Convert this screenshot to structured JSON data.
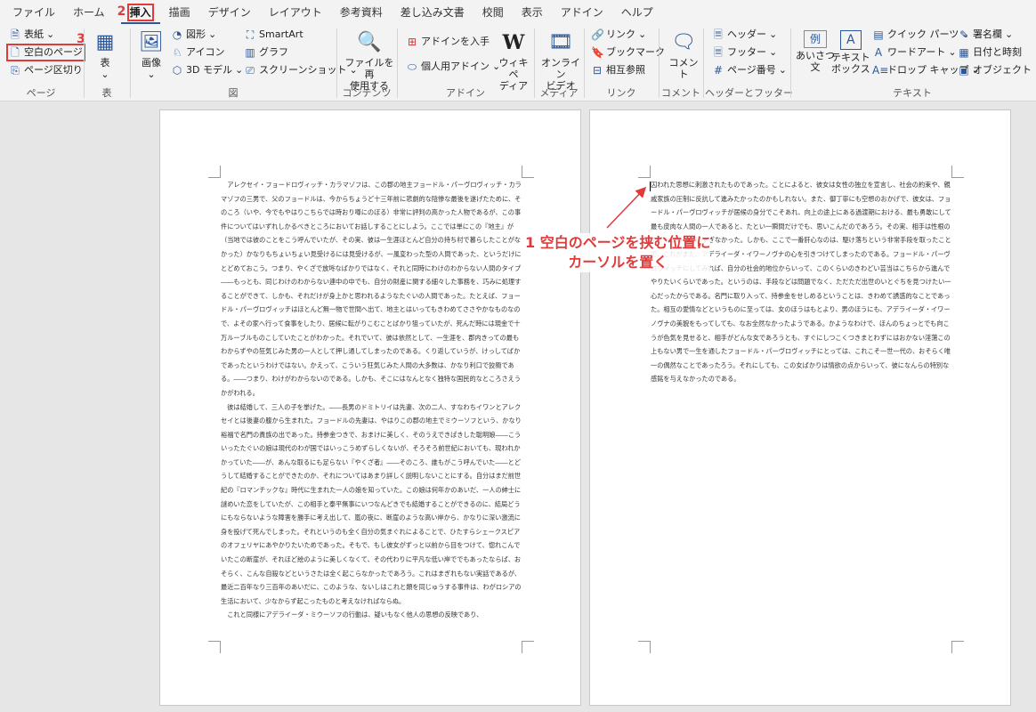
{
  "menu": {
    "tabs": [
      "ファイル",
      "ホーム",
      "挿入",
      "描画",
      "デザイン",
      "レイアウト",
      "参考資料",
      "差し込み文書",
      "校閲",
      "表示",
      "アドイン",
      "ヘルプ"
    ],
    "active_tab": "挿入"
  },
  "steps": {
    "step1": "1",
    "step2": "2",
    "step3": "3"
  },
  "ribbon": {
    "pages": {
      "label": "ページ",
      "cover": "表紙",
      "blank": "空白のページ",
      "break": "ページ区切り"
    },
    "table": {
      "label": "表",
      "button": "表"
    },
    "illustrations": {
      "label": "図",
      "picture": "画像",
      "shapes": "図形",
      "icons": "アイコン",
      "3d": "3D モデル",
      "smartart": "SmartArt",
      "chart": "グラフ",
      "screenshot": "スクリーンショット"
    },
    "content": {
      "label": "コンテンツ",
      "reuse_line1": "ファイルを再",
      "reuse_line2": "使用する"
    },
    "addins": {
      "label": "アドイン",
      "get": "アドインを入手",
      "my": "個人用アドイン",
      "wiki_line1": "ウィキペ",
      "wiki_line2": "ディア"
    },
    "media": {
      "label": "メディア",
      "video_line1": "オンライン",
      "video_line2": "ビデオ"
    },
    "links": {
      "label": "リンク",
      "link": "リンク",
      "bookmark": "ブックマーク",
      "crossref": "相互参照"
    },
    "comments": {
      "label": "コメント",
      "comment": "コメント"
    },
    "header_footer": {
      "label": "ヘッダーとフッター",
      "header": "ヘッダー",
      "footer": "フッター",
      "page_number": "ページ番号"
    },
    "text": {
      "label": "テキスト",
      "greeting_line1": "あいさつ",
      "greeting_line2": "文",
      "textbox_line1": "テキスト",
      "textbox_line2": "ボックス",
      "quickparts": "クイック パーツ",
      "wordart": "ワードアート",
      "dropcap": "ドロップ キャップ",
      "signature": "署名欄",
      "datetime": "日付と時刻",
      "object": "オブジェクト"
    }
  },
  "document": {
    "left_page_paragraphs": [
      "アレクセイ・フョードロヴィッチ・カラマゾフは、この郡の地主フョードル・パーヴロヴィッチ・カラマゾフの三男で、父のフョードルは、今からちょうど十三年前に悲劇的な陰惨な最後を遂げたために、そのころ（いや、今でもやはりこちらでは時おり噂にのぼる）非常に評判の高かった人物であるが、この事件についてはいずれしかるべきところにおいてお話しすることにしよう。ここでは単にこの『地主』が（当地では彼のことをこう呼んでいたが、その実、彼は一生涯ほとんど自分の持ち村で暮らしたことがなかった）かなりもちょいちょい見受けるには見受けるが、一風変わった型の人間であった、というだけにとどめておこう。つまり、やくざで放埓なばかりではなく、それと同時にわけのわからない人間のタイプ――もっとも、同じわけのわからない連中の中でも、自分の財産に関する細々した事務を、巧みに処理することができて、しかも、それだけが身上かと思われるようなたぐいの人間であった。たとえば、フョードル・パーヴロヴィッチはほとんど無一物で世間へ出て、地主とはいってもきわめてささやかなものなので、よその家へ行って食事をしたり、居候に転がりこむことばかり狙っていたが、死んだ時には現金で十万ルーブルものこしていたことがわかった。それでいて、彼は依然として、一生涯を、郡内きっての最もわからずやの狂気じみた男の一人として押し通してしまったのである。くり返していうが、けっしてばかであったというわけではない。かえって、こういう狂気じみた人間の大多数は、かなり利口で狡猾である。――つまり、わけがわからないのである。しかも、そこにはなんとなく独特な国民的なところさえうかがわれる。",
      "彼は結婚して、三人の子を挙げた。――長男のドミトリイは先妻、次の二人、すなわちイワンとアレクセイとは後妻の腹から生まれた。フョードルの先妻は、やはりこの郡の地主でミウーソフという、かなり裕福で名門の貴族の出であった。持参金つきで、おまけに美しく、そのうえできぱきした聡明娘――こういったたぐいの娘は現代のわが国ではいっこうめずらしくないが、そろそろ前世紀においても、現われかかっていた――が、あんな取るにも足らない『やくざ者』――そのころ、誰もがこう呼んでいた――とどうして結婚することができたのか、それについてはあまり詳しく説明しないことにする。自分はまだ前世紀の『ロマンチックな』時代に生まれた一人の娘を知っていた。この娘は何年かのあいだ、一人の紳士に謎めいた恋をしていたが、この相手と泰平無事にいつなんどきでも結婚することができるのに、結局どうにもならないような障害を勝手に考え出して、嵐の夜に、断崖のような高い岸から、かなりに深い激流に身を投げて死んでしまった。それというのも全く自分の気まぐれによることで、ひたすらシェークスピアのオフェリヤにあやかりたいためであった。そもで、もし彼女がずっと以前から目をつけて、惚れこんでいたこの断崖が、それほど絵のように美しくなくて、その代わりに平凡な低い岸ででもあったならば、おそらく、こんな自殺などというさたは全く起こらなかったであろう。これはまぎれもない実話であるが、最近二百年なり三百年のあいだに、このような、ないしはこれと類を同じゅうする事件は、わがロシアの生活において、少なからず起こったものと考えなければならぬ。",
      "これと同様にアデライーダ・ミウーソフの行動は、疑いもなく他人の思想の反映であり、"
    ],
    "right_page_paragraphs": [
      "囚われた思想に刺激されたものであった。ことによると、彼女は女性の独立を宣言し、社会の約束や、親戚家族の圧制に反抗して進みたかったのかもしれない。また、御丁寧にも空想のおかげで、彼女は、フョードル・パーヴロヴィッチが居候の身分でこそあれ、向上の途上にある過渡期における、最も勇敢にして最も皮肉な人間の一人であると、たとい一瞬間だけでも、思いこんだのであろう。その実、相手は性根のよくない道化者にすぎなかった。しかも、ここで一番肝心なのは、駆け落ちという非常手段を取ったことで、これがまた、アデライーダ・イワーノヴナの心を引きつけてしまったのである。フョードル・パーヴロヴィッチにしてみれば、自分の社会的地位からいって、このくらいのきわどい芸当はこちらから進んでやりたいくらいであった。というのは、手段などは問題でなく、ただただ出世のいとぐちを見つけたい一心だったからである。名門に取り入って、持参金をせしめるということは、きわめて誘惑的なことであった。相互の愛情などというものに至っては、女のほうはもとより、男のほうにも、アデライーダ・イワーノヴナの美貌をもってしても、なお全然なかったようである。かようなわけで、ほんのちょっとでも向こうが色気を見せると、相手がどんな女であろうとも、すぐにしつこくつきまとわずにはおかない淫蕩この上もない男で一生を通したフョードル・パーヴロヴィッチにとっては、これこそ一世一代の、おそらく唯一の偶然なことであったろう。それにしても、この女ばかりは情欲の点からいって、彼になんらの特別な感銘を与えなかったのである。"
    ]
  },
  "annotation": {
    "line1": "1 空白のページを挟む位置に",
    "line2": "カーソルを置く"
  },
  "colors": {
    "annotation": "#e03a3a",
    "accent": "#2b579a"
  }
}
